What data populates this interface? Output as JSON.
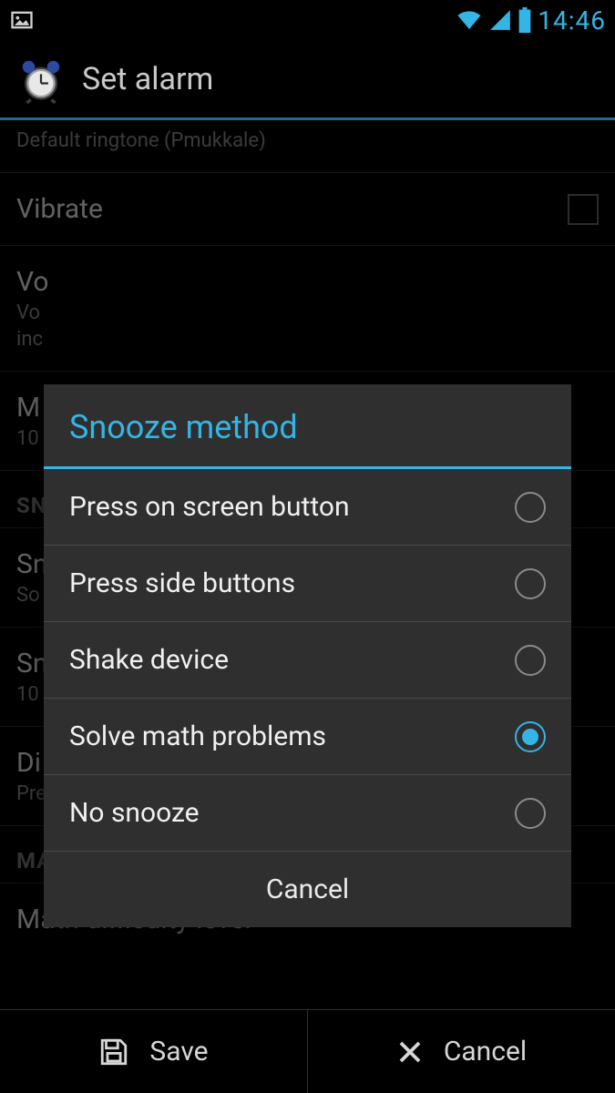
{
  "statusbar": {
    "time": "14:46"
  },
  "header": {
    "title": "Set alarm"
  },
  "list": {
    "ringtone_sub": "Default ringtone (Pmukkale)",
    "vibrate": "Vibrate",
    "volume_title": "Vo",
    "volume_sub1": "Vo",
    "volume_sub2": "inc",
    "duration_title": "M",
    "duration_sub": "10",
    "snooze_section": "SN",
    "snooze_method_title": "Sn",
    "snooze_method_sub": "So",
    "snooze_duration_title": "Sn",
    "snooze_duration_sub": "10",
    "dismiss_title": "Di",
    "dismiss_sub": "Pre",
    "math_section": "MATH SETTINGS",
    "math_level_title": "Math difficulty level"
  },
  "actions": {
    "save": "Save",
    "cancel": "Cancel"
  },
  "dialog": {
    "title": "Snooze method",
    "options": [
      {
        "label": "Press on screen button",
        "selected": false
      },
      {
        "label": "Press side buttons",
        "selected": false
      },
      {
        "label": "Shake device",
        "selected": false
      },
      {
        "label": "Solve math problems",
        "selected": true
      },
      {
        "label": "No snooze",
        "selected": false
      }
    ],
    "cancel": "Cancel"
  }
}
